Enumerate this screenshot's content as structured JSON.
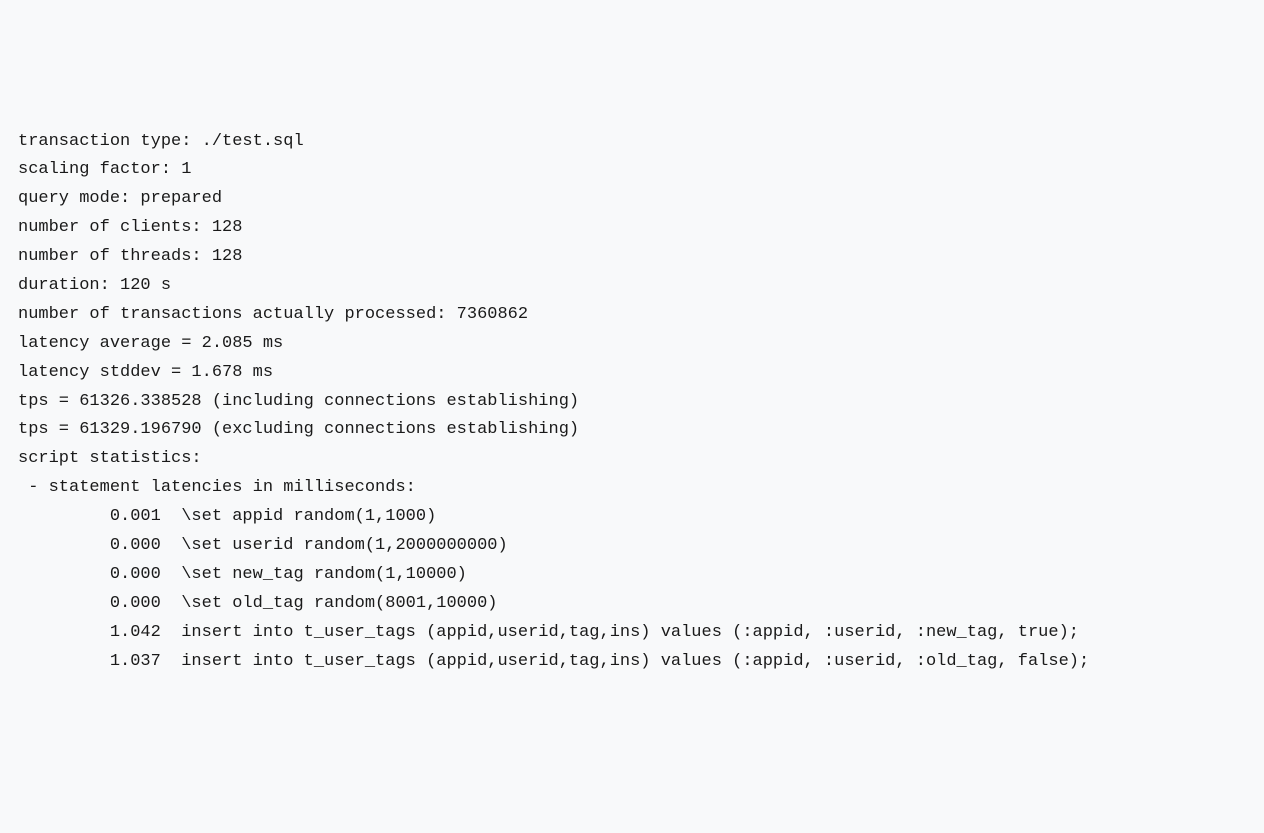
{
  "lines": [
    "transaction type: ./test.sql",
    "scaling factor: 1",
    "query mode: prepared",
    "number of clients: 128",
    "number of threads: 128",
    "duration: 120 s",
    "number of transactions actually processed: 7360862",
    "latency average = 2.085 ms",
    "latency stddev = 1.678 ms",
    "tps = 61326.338528 (including connections establishing)",
    "tps = 61329.196790 (excluding connections establishing)",
    "script statistics:",
    " - statement latencies in milliseconds:",
    "         0.001  \\set appid random(1,1000)",
    "         0.000  \\set userid random(1,2000000000)",
    "         0.000  \\set new_tag random(1,10000)",
    "         0.000  \\set old_tag random(8001,10000)",
    "         1.042  insert into t_user_tags (appid,userid,tag,ins) values (:appid, :userid, :new_tag, true);",
    "         1.037  insert into t_user_tags (appid,userid,tag,ins) values (:appid, :userid, :old_tag, false);"
  ]
}
